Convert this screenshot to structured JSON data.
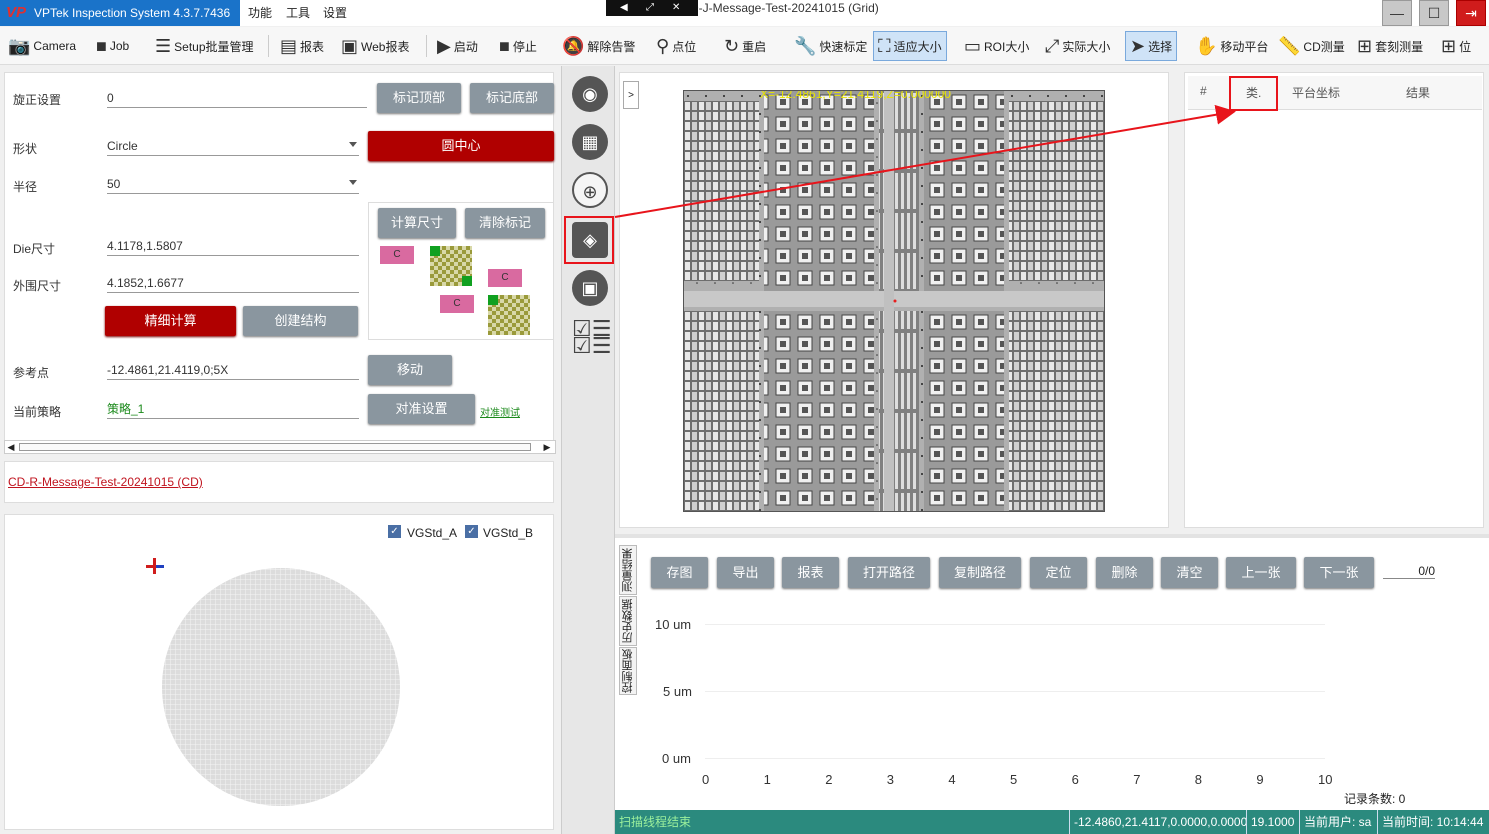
{
  "titlebar": {
    "app_title": "VPTek Inspection System 4.3.7.7436",
    "logo_text": "VP",
    "menu": [
      "功能",
      "工具",
      "设置"
    ],
    "doc_title": "D-J-Message-Test-20241015 (Grid)"
  },
  "toolbar": {
    "items": [
      {
        "label": "Camera",
        "icon": "camera-icon"
      },
      {
        "label": "Job",
        "icon": "briefcase-icon"
      },
      {
        "label": "Setup批量管理",
        "icon": "checklist-icon"
      },
      {
        "label": "报表",
        "icon": "report-icon"
      },
      {
        "label": "Web报表",
        "icon": "web-report-icon"
      },
      {
        "label": "启动",
        "icon": "play-icon"
      },
      {
        "label": "停止",
        "icon": "stop-icon"
      },
      {
        "label": "解除告警",
        "icon": "bell-off-icon"
      },
      {
        "label": "点位",
        "icon": "pin-icon"
      },
      {
        "label": "重启",
        "icon": "restart-icon"
      },
      {
        "label": "快速标定",
        "icon": "wrench-icon"
      },
      {
        "label": "适应大小",
        "icon": "fit-icon"
      },
      {
        "label": "ROI大小",
        "icon": "roi-icon"
      },
      {
        "label": "实际大小",
        "icon": "expand-icon"
      },
      {
        "label": "选择",
        "icon": "cursor-icon"
      },
      {
        "label": "移动平台",
        "icon": "hand-icon"
      },
      {
        "label": "CD测量",
        "icon": "ruler-icon"
      },
      {
        "label": "套刻测量",
        "icon": "plus-icon"
      },
      {
        "label": "位",
        "icon": "plus-icon"
      }
    ]
  },
  "left": {
    "rotation_label": "旋正设置",
    "rotation_value": "0",
    "mark_top": "标记顶部",
    "mark_bottom": "标记底部",
    "shape_label": "形状",
    "shape_value": "Circle",
    "circle_center": "圆中心",
    "radius_label": "半径",
    "radius_value": "50",
    "calc_size": "计算尺寸",
    "clear_marks": "清除标记",
    "die_label": "Die尺寸",
    "die_value": "4.1178,1.5807",
    "outer_label": "外围尺寸",
    "outer_value": "4.1852,1.6677",
    "fine_calc": "精细计算",
    "create_struct": "创建结构",
    "ref_label": "参考点",
    "ref_value": "-12.4861,21.4119,0;5X",
    "move": "移动",
    "strategy_label": "当前策略",
    "strategy_value": "策略_1",
    "align_settings": "对准设置",
    "align_test": "对准测试",
    "mark_c": "C",
    "recipe_link": "CD-R-Message-Test-20241015 (CD)",
    "vg_a": "VGStd_A",
    "vg_b": "VGStd_B"
  },
  "image_view": {
    "toggle": ">",
    "overlay_text": "X=-12.4861,Y=21.4119,Z=0.000000"
  },
  "results": {
    "headers": [
      "#",
      "类.",
      "平台坐标",
      "结果"
    ]
  },
  "bottom": {
    "buttons": [
      "存图",
      "导出",
      "报表",
      "打开路径",
      "复制路径",
      "定位",
      "删除",
      "清空",
      "上一张",
      "下一张"
    ],
    "page": "0/0",
    "tabs": [
      "测量结果",
      "历史数据",
      "控制面板"
    ],
    "y_ticks": [
      "10 um",
      "5 um",
      "0 um"
    ],
    "x_ticks": [
      "0",
      "1",
      "2",
      "3",
      "4",
      "5",
      "6",
      "7",
      "8",
      "9",
      "10"
    ],
    "record_count": "记录条数: 0"
  },
  "status": {
    "left": "扫描线程结束",
    "coords": "-12.4860,21.4117,0.0000,0.0000",
    "value": "19.1000",
    "user": "当前用户:  sa",
    "time": "当前时间:  10:14:44"
  },
  "colors": {
    "title_blue": "#1a73c9",
    "accent_red": "#b00000",
    "button_gray": "#8a969f",
    "status_teal": "#2b8a7e",
    "annotation_red": "#e8141b"
  }
}
